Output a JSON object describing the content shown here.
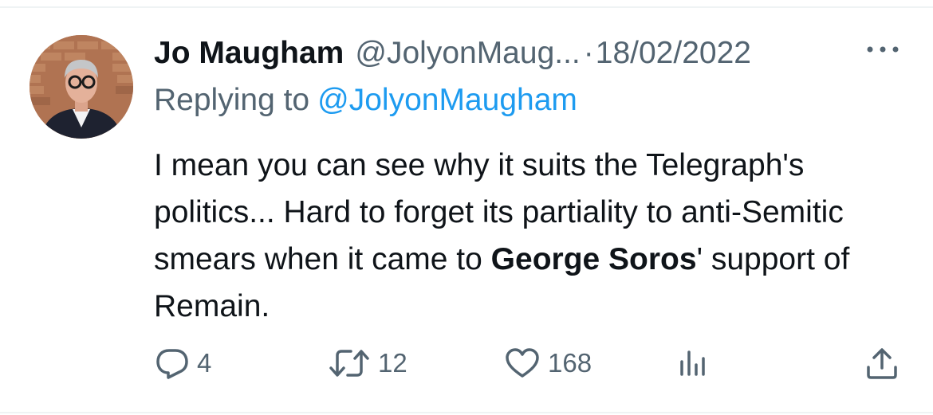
{
  "tweet": {
    "author_name": "Jo Maugham",
    "author_handle": "@JolyonMaug...",
    "separator": "·",
    "date": "18/02/2022",
    "replying_prefix": "Replying to",
    "replying_handle": "@JolyonMaugham",
    "text_parts": [
      "I mean you can see why it suits the Telegraph's politics... Hard to forget its partiality to anti-Semitic smears when it came to ",
      "George Soros",
      "' support of Remain."
    ],
    "bold_phrase": "George Soros"
  },
  "actions": {
    "reply": {
      "icon": "reply-icon",
      "count": "4"
    },
    "retweet": {
      "icon": "retweet-icon",
      "count": "12"
    },
    "like": {
      "icon": "heart-icon",
      "count": "168"
    },
    "views": {
      "icon": "views-icon"
    },
    "share": {
      "icon": "share-icon"
    }
  },
  "colors": {
    "text": "#0f1419",
    "secondary": "#536471",
    "link": "#1d9bf0",
    "divider": "#eff3f4"
  }
}
